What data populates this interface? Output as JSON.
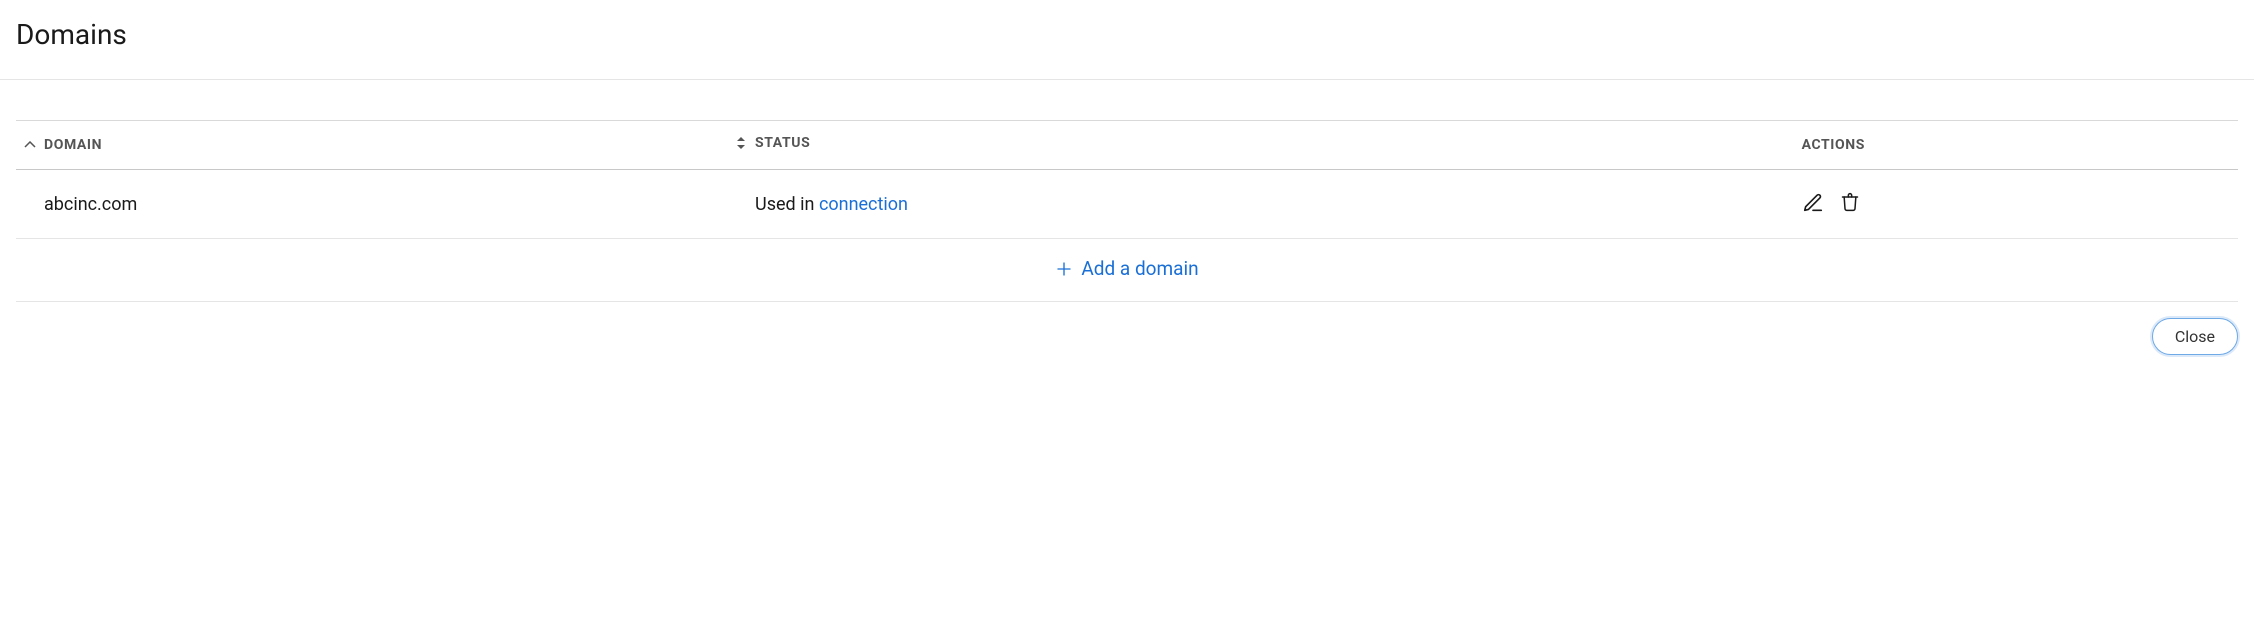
{
  "page": {
    "title": "Domains"
  },
  "table": {
    "columns": {
      "domain": "DOMAIN",
      "status": "STATUS",
      "actions": "ACTIONS"
    },
    "rows": [
      {
        "domain": "abcinc.com",
        "status_prefix": "Used in ",
        "status_link_label": "connection"
      }
    ],
    "add_label": "Add a domain"
  },
  "footer": {
    "close_label": "Close"
  }
}
